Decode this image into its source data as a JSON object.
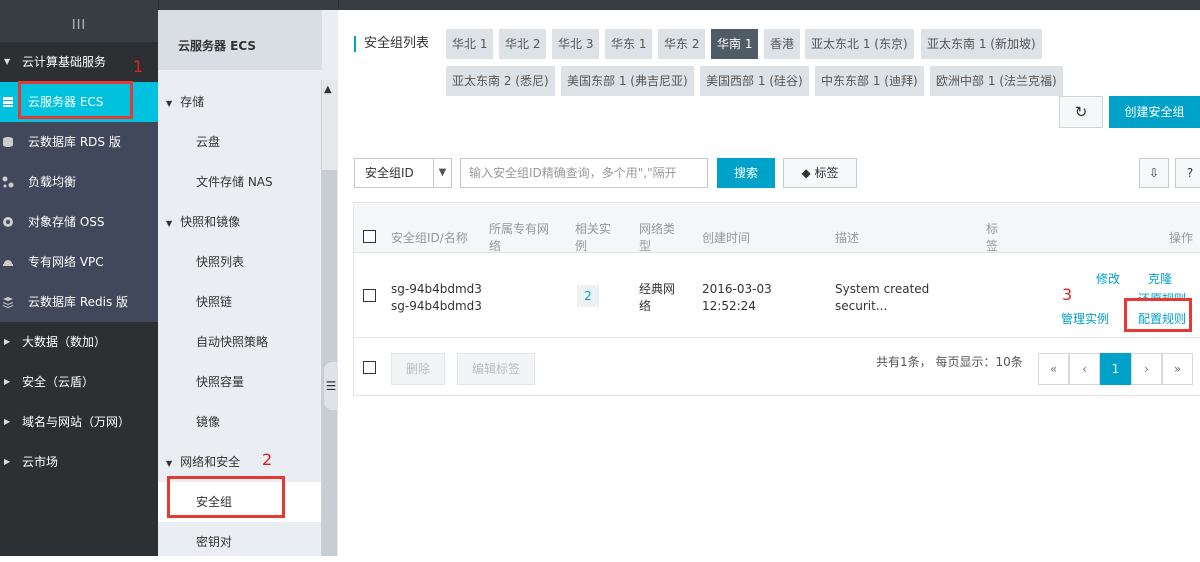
{
  "left_nav": {
    "collapse_label": "III",
    "groups": [
      {
        "label": "云计算基础服务",
        "caret": "▼"
      },
      {
        "label": "大数据（数加）",
        "caret": "▶"
      },
      {
        "label": "安全（云盾）",
        "caret": "▶"
      },
      {
        "label": "域名与网站（万网）",
        "caret": "▶"
      },
      {
        "label": "云市场",
        "caret": "▶"
      }
    ],
    "items": [
      {
        "label": "云服务器 ECS",
        "icon": "server-icon"
      },
      {
        "label": "云数据库 RDS 版",
        "icon": "database-icon"
      },
      {
        "label": "负载均衡",
        "icon": "load-balancer-icon"
      },
      {
        "label": "对象存储 OSS",
        "icon": "storage-icon"
      },
      {
        "label": "专有网络 VPC",
        "icon": "network-icon"
      },
      {
        "label": "云数据库 Redis 版",
        "icon": "redis-icon"
      }
    ]
  },
  "annotations": {
    "one": "1",
    "two": "2",
    "three": "3"
  },
  "sub_nav": {
    "title": "云服务器 ECS",
    "sections": [
      {
        "label": "存储",
        "items": [
          "云盘",
          "文件存储 NAS"
        ]
      },
      {
        "label": "快照和镜像",
        "items": [
          "快照列表",
          "快照链",
          "自动快照策略",
          "快照容量",
          "镜像"
        ]
      },
      {
        "label": "网络和安全",
        "items": [
          "安全组",
          "密钥对"
        ]
      }
    ]
  },
  "main": {
    "title": "安全组列表",
    "regions_row1": [
      "华北 1",
      "华北 2",
      "华北 3",
      "华东 1",
      "华东 2",
      "华南 1",
      "香港",
      "亚太东北 1 (东京)",
      "亚太东南 1 (新加坡)"
    ],
    "regions_row2": [
      "亚太东南 2 (悉尼)",
      "美国东部 1 (弗吉尼亚)",
      "美国西部 1 (硅谷)",
      "中东东部 1 (迪拜)",
      "欧洲中部 1 (法兰克福)"
    ],
    "active_region": "华南 1",
    "refresh_icon": "↻",
    "create_label": "创建安全组",
    "search": {
      "select_value": "安全组ID",
      "placeholder": "输入安全组ID精确查询，多个用\",\"隔开",
      "search_label": "搜索",
      "tag_label": "标签"
    },
    "help_label": "?",
    "table": {
      "headers": {
        "id": "安全组ID/名称",
        "vpc_1": "所属专有网",
        "vpc_2": "络",
        "inst_1": "相关实",
        "inst_2": "例",
        "type_1": "网络类",
        "type_2": "型",
        "created": "创建时间",
        "desc": "描述",
        "tag_1": "标",
        "tag_2": "签",
        "ops": "操作"
      },
      "row": {
        "id": "sg-94b4bdmd3",
        "name": "sg-94b4bdmd3",
        "instance_count": "2",
        "type_1": "经典网",
        "type_2": "络",
        "date": "2016-03-03",
        "time": "12:52:24",
        "desc_1": "System created",
        "desc_2": "securit...",
        "ops": {
          "modify": "修改",
          "clone": "克隆",
          "restore": "还原规则",
          "manage": "管理实例",
          "config": "配置规则"
        }
      },
      "footer": {
        "delete_label": "删除",
        "edit_tags_label": "编辑标签",
        "page_info": "共有1条， 每页显示：10条",
        "pager": {
          "first": "«",
          "prev": "‹",
          "current": "1",
          "next": "›",
          "last": "»"
        }
      }
    }
  },
  "colors": {
    "accent": "#00a2ca",
    "nav_active": "#00c1de",
    "annotation": "#e02020"
  }
}
